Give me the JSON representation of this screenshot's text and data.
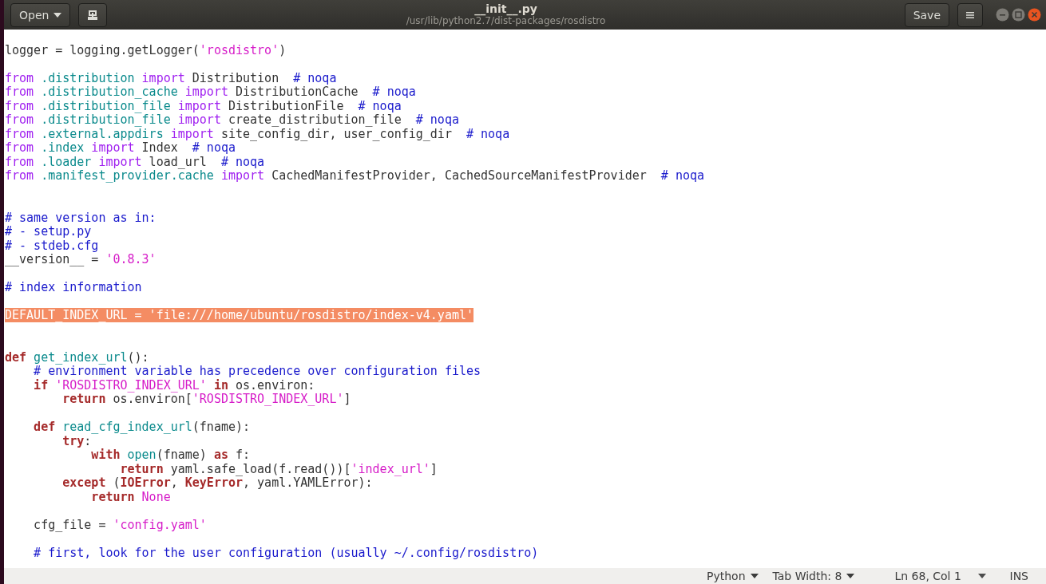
{
  "header": {
    "open_button": "Open",
    "title": "__init__.py",
    "subtitle": "/usr/lib/python2.7/dist-packages/rosdistro",
    "save_button": "Save"
  },
  "editor": {
    "lines": [
      {
        "kind": "blank"
      },
      {
        "kind": "code",
        "tokens": [
          {
            "t": "logger = logging.getLogger(",
            "kind": "plain"
          },
          {
            "t": "'rosdistro'",
            "kind": "string"
          },
          {
            "t": ")",
            "kind": "plain"
          }
        ]
      },
      {
        "kind": "blank"
      },
      {
        "kind": "code",
        "tokens": [
          {
            "t": "from",
            "kind": "import"
          },
          {
            "t": " .distribution",
            "kind": "module"
          },
          {
            "t": " import",
            "kind": "import"
          },
          {
            "t": " Distribution  ",
            "kind": "plain"
          },
          {
            "t": "# noqa",
            "kind": "comment"
          }
        ]
      },
      {
        "kind": "code",
        "tokens": [
          {
            "t": "from",
            "kind": "import"
          },
          {
            "t": " .distribution_cache",
            "kind": "module"
          },
          {
            "t": " import",
            "kind": "import"
          },
          {
            "t": " DistributionCache  ",
            "kind": "plain"
          },
          {
            "t": "# noqa",
            "kind": "comment"
          }
        ]
      },
      {
        "kind": "code",
        "tokens": [
          {
            "t": "from",
            "kind": "import"
          },
          {
            "t": " .distribution_file",
            "kind": "module"
          },
          {
            "t": " import",
            "kind": "import"
          },
          {
            "t": " DistributionFile  ",
            "kind": "plain"
          },
          {
            "t": "# noqa",
            "kind": "comment"
          }
        ]
      },
      {
        "kind": "code",
        "tokens": [
          {
            "t": "from",
            "kind": "import"
          },
          {
            "t": " .distribution_file",
            "kind": "module"
          },
          {
            "t": " import",
            "kind": "import"
          },
          {
            "t": " create_distribution_file  ",
            "kind": "plain"
          },
          {
            "t": "# noqa",
            "kind": "comment"
          }
        ]
      },
      {
        "kind": "code",
        "tokens": [
          {
            "t": "from",
            "kind": "import"
          },
          {
            "t": " .external.appdirs",
            "kind": "module"
          },
          {
            "t": " import",
            "kind": "import"
          },
          {
            "t": " site_config_dir, user_config_dir  ",
            "kind": "plain"
          },
          {
            "t": "# noqa",
            "kind": "comment"
          }
        ]
      },
      {
        "kind": "code",
        "tokens": [
          {
            "t": "from",
            "kind": "import"
          },
          {
            "t": " .index",
            "kind": "module"
          },
          {
            "t": " import",
            "kind": "import"
          },
          {
            "t": " Index  ",
            "kind": "plain"
          },
          {
            "t": "# noqa",
            "kind": "comment"
          }
        ]
      },
      {
        "kind": "code",
        "tokens": [
          {
            "t": "from",
            "kind": "import"
          },
          {
            "t": " .loader",
            "kind": "module"
          },
          {
            "t": " import",
            "kind": "import"
          },
          {
            "t": " load_url  ",
            "kind": "plain"
          },
          {
            "t": "# noqa",
            "kind": "comment"
          }
        ]
      },
      {
        "kind": "code",
        "tokens": [
          {
            "t": "from",
            "kind": "import"
          },
          {
            "t": " .manifest_provider.cache",
            "kind": "module"
          },
          {
            "t": " import",
            "kind": "import"
          },
          {
            "t": " CachedManifestProvider, CachedSourceManifestProvider  ",
            "kind": "plain"
          },
          {
            "t": "# noqa",
            "kind": "comment"
          }
        ]
      },
      {
        "kind": "blank"
      },
      {
        "kind": "blank"
      },
      {
        "kind": "code",
        "tokens": [
          {
            "t": "# same version as in:",
            "kind": "comment"
          }
        ]
      },
      {
        "kind": "code",
        "tokens": [
          {
            "t": "# - setup.py",
            "kind": "comment"
          }
        ]
      },
      {
        "kind": "code",
        "tokens": [
          {
            "t": "# - stdeb.cfg",
            "kind": "comment"
          }
        ]
      },
      {
        "kind": "code",
        "tokens": [
          {
            "t": "__version__ = ",
            "kind": "plain"
          },
          {
            "t": "'0.8.3'",
            "kind": "string"
          }
        ]
      },
      {
        "kind": "blank"
      },
      {
        "kind": "code",
        "tokens": [
          {
            "t": "# index information",
            "kind": "comment"
          }
        ]
      },
      {
        "kind": "blank"
      },
      {
        "kind": "code",
        "tokens": [
          {
            "t": "DEFAULT_INDEX_URL = 'file:///home/ubuntu/rosdistro/index-v4.yaml'",
            "kind": "highlighted"
          }
        ]
      },
      {
        "kind": "blank"
      },
      {
        "kind": "blank"
      },
      {
        "kind": "code",
        "tokens": [
          {
            "t": "def",
            "kind": "keyword"
          },
          {
            "t": " get_index_url",
            "kind": "function"
          },
          {
            "t": "():",
            "kind": "plain"
          }
        ]
      },
      {
        "kind": "code",
        "tokens": [
          {
            "t": "    # environment variable has precedence over configuration files",
            "kind": "comment"
          }
        ]
      },
      {
        "kind": "code",
        "tokens": [
          {
            "t": "    if",
            "kind": "keyword"
          },
          {
            "t": " 'ROSDISTRO_INDEX_URL'",
            "kind": "string"
          },
          {
            "t": " in",
            "kind": "keyword"
          },
          {
            "t": " os.environ:",
            "kind": "plain"
          }
        ]
      },
      {
        "kind": "code",
        "tokens": [
          {
            "t": "        return",
            "kind": "keyword"
          },
          {
            "t": " os.environ[",
            "kind": "plain"
          },
          {
            "t": "'ROSDISTRO_INDEX_URL'",
            "kind": "string"
          },
          {
            "t": "]",
            "kind": "plain"
          }
        ]
      },
      {
        "kind": "blank"
      },
      {
        "kind": "code",
        "tokens": [
          {
            "t": "    def",
            "kind": "keyword"
          },
          {
            "t": " read_cfg_index_url",
            "kind": "function"
          },
          {
            "t": "(fname):",
            "kind": "plain"
          }
        ]
      },
      {
        "kind": "code",
        "tokens": [
          {
            "t": "        try",
            "kind": "keyword"
          },
          {
            "t": ":",
            "kind": "plain"
          }
        ]
      },
      {
        "kind": "code",
        "tokens": [
          {
            "t": "            with",
            "kind": "keyword"
          },
          {
            "t": " open",
            "kind": "builtin"
          },
          {
            "t": "(fname) ",
            "kind": "plain"
          },
          {
            "t": "as",
            "kind": "keyword"
          },
          {
            "t": " f:",
            "kind": "plain"
          }
        ]
      },
      {
        "kind": "code",
        "tokens": [
          {
            "t": "                return",
            "kind": "keyword"
          },
          {
            "t": " yaml.safe_load(f.read())[",
            "kind": "plain"
          },
          {
            "t": "'index_url'",
            "kind": "string"
          },
          {
            "t": "]",
            "kind": "plain"
          }
        ]
      },
      {
        "kind": "code",
        "tokens": [
          {
            "t": "        except",
            "kind": "keyword"
          },
          {
            "t": " (",
            "kind": "plain"
          },
          {
            "t": "IOError",
            "kind": "keyword"
          },
          {
            "t": ", ",
            "kind": "plain"
          },
          {
            "t": "KeyError",
            "kind": "keyword"
          },
          {
            "t": ", yaml.YAMLError):",
            "kind": "plain"
          }
        ]
      },
      {
        "kind": "code",
        "tokens": [
          {
            "t": "            return",
            "kind": "keyword"
          },
          {
            "t": " None",
            "kind": "constant"
          }
        ]
      },
      {
        "kind": "blank"
      },
      {
        "kind": "code",
        "tokens": [
          {
            "t": "    cfg_file = ",
            "kind": "plain"
          },
          {
            "t": "'config.yaml'",
            "kind": "string"
          }
        ]
      },
      {
        "kind": "blank"
      },
      {
        "kind": "code",
        "tokens": [
          {
            "t": "    # first, look for the user configuration (usually ~/.config/rosdistro)",
            "kind": "comment"
          }
        ]
      }
    ]
  },
  "status_bar": {
    "language": "Python",
    "tab_width": "Tab Width: 8",
    "position": "Ln 68, Col 1",
    "mode": "INS"
  }
}
